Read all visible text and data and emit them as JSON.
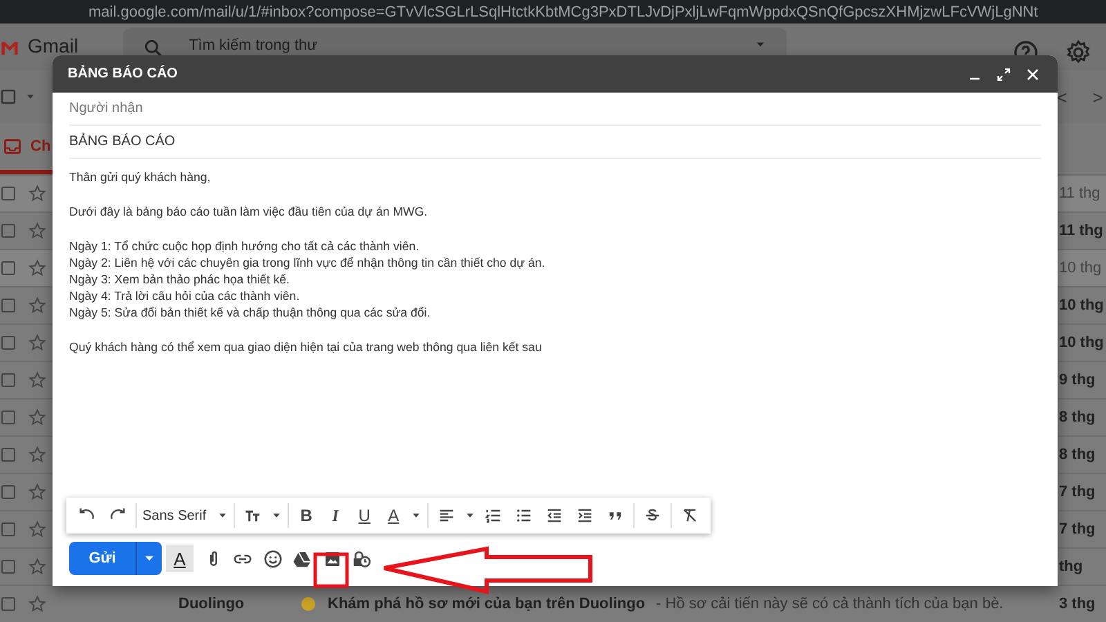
{
  "browser": {
    "url": "mail.google.com/mail/u/1/#inbox?compose=GTvVlcSGLrLSqlHtctkKbtMCg3PxDTLJvDjPxljLwFqmWppdxQSnQfGpcszXHMjzwLFcVWjLgNNt"
  },
  "header": {
    "app_name": "Gmail",
    "search_placeholder": "Tìm kiếm trong thư"
  },
  "tabs": [
    {
      "label": "Ch",
      "selected": true
    }
  ],
  "pager": {
    "prev": "<",
    "next": ">"
  },
  "rows": [
    {
      "date": "11 thg",
      "unread": false
    },
    {
      "date": "11 thg",
      "unread": true
    },
    {
      "date": "10 thg",
      "unread": false
    },
    {
      "date": "10 thg",
      "unread": true
    },
    {
      "date": "10 thg",
      "unread": true
    },
    {
      "date": "9 thg",
      "unread": true
    },
    {
      "date": "8 thg",
      "unread": true
    },
    {
      "date": "8 thg",
      "unread": true
    },
    {
      "date": "7 thg",
      "unread": true
    },
    {
      "date": "7 thg",
      "unread": true
    },
    {
      "date": "thg",
      "unread": true
    },
    {
      "date": "3 thg",
      "unread": true,
      "sender": "Duolingo",
      "subject": "Khám phá hồ sơ mới của bạn trên Duolingo",
      "snippet": " - Hồ sơ cải tiến này sẽ có cả thành tích của bạn bè."
    }
  ],
  "compose": {
    "title": "BẢNG BÁO CÁO",
    "recipients_placeholder": "Người nhận",
    "subject": "BẢNG BÁO CÁO",
    "body": [
      [
        "Thân gửi quý khách hàng,"
      ],
      [
        "Dưới đây là bảng báo cáo tuần làm việc đầu tiên của dự án MWG."
      ],
      [
        "Ngày 1: Tổ chức cuộc họp định hướng cho tất cả các thành viên.",
        "Ngày 2: Liên hệ với các chuyên gia trong lĩnh vực để nhận thông tin cần thiết cho dự án.",
        "Ngày 3: Xem bản thảo phác họa thiết kế.",
        "Ngày 4: Trả lời câu hỏi của các thành viên.",
        "Ngày 5: Sửa đổi bản thiết kế và chấp thuận thông qua các sửa đổi."
      ],
      [
        "Quý khách hàng có thể xem qua giao diện hiện tại của trang web thông qua liên kết sau"
      ]
    ],
    "font": "Sans Serif",
    "format_letters": [
      "B",
      "I",
      "U",
      "A"
    ],
    "formatting_toggle": {
      "label": "A",
      "on": true
    },
    "send_label": "Gửi"
  }
}
